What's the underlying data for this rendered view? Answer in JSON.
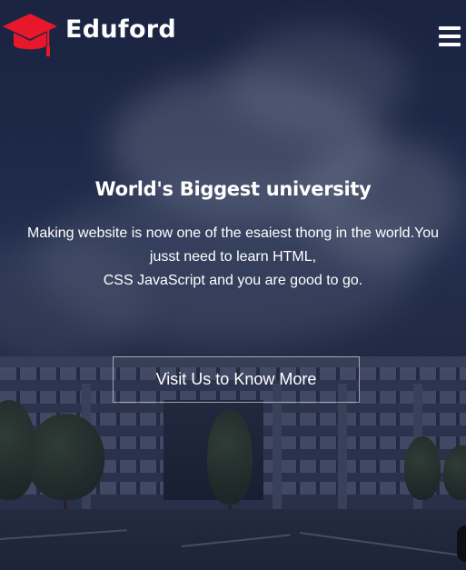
{
  "header": {
    "brand": "Eduford",
    "logo_icon": "graduation-cap-icon",
    "menu_icon": "hamburger-menu-icon"
  },
  "hero": {
    "headline": "World's Biggest university",
    "subtext_lines": [
      "Making website is now one of the esaiest thong in the world.You",
      "jusst need to learn HTML,",
      "CSS JavaScript and you are good to go."
    ],
    "cta_label": "Visit Us to Know More"
  },
  "colors": {
    "accent_red": "#e8182a",
    "text_white": "#ffffff",
    "overlay": "#141a30"
  }
}
